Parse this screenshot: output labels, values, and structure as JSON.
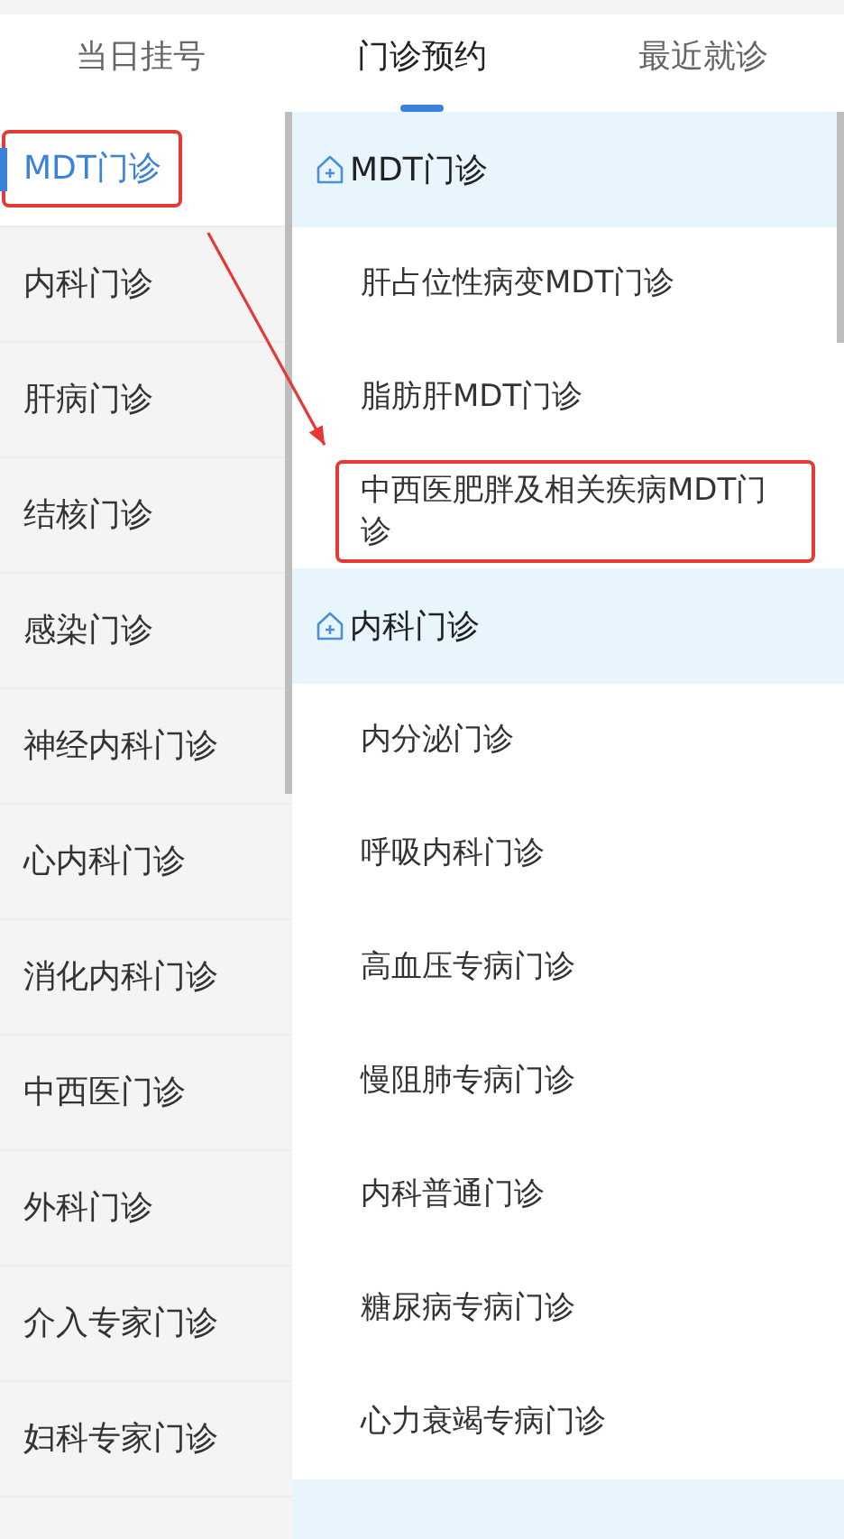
{
  "tabs": [
    {
      "label": "当日挂号",
      "selected": false
    },
    {
      "label": "门诊预约",
      "selected": true
    },
    {
      "label": "最近就诊",
      "selected": false
    }
  ],
  "sidebar": {
    "items": [
      {
        "label": "MDT门诊",
        "selected": true,
        "highlighted": true
      },
      {
        "label": "内科门诊",
        "selected": false,
        "highlighted": false
      },
      {
        "label": "肝病门诊",
        "selected": false,
        "highlighted": false
      },
      {
        "label": "结核门诊",
        "selected": false,
        "highlighted": false
      },
      {
        "label": "感染门诊",
        "selected": false,
        "highlighted": false
      },
      {
        "label": "神经内科门诊",
        "selected": false,
        "highlighted": false
      },
      {
        "label": "心内科门诊",
        "selected": false,
        "highlighted": false
      },
      {
        "label": "消化内科门诊",
        "selected": false,
        "highlighted": false
      },
      {
        "label": "中西医门诊",
        "selected": false,
        "highlighted": false
      },
      {
        "label": "外科门诊",
        "selected": false,
        "highlighted": false
      },
      {
        "label": "介入专家门诊",
        "selected": false,
        "highlighted": false
      },
      {
        "label": "妇科专家门诊",
        "selected": false,
        "highlighted": false
      }
    ]
  },
  "sections": [
    {
      "title": "MDT门诊",
      "items": [
        {
          "label": "肝占位性病变MDT门诊",
          "highlighted": false
        },
        {
          "label": "脂肪肝MDT门诊",
          "highlighted": false
        },
        {
          "label": "中西医肥胖及相关疾病MDT门诊",
          "highlighted": true
        }
      ]
    },
    {
      "title": "内科门诊",
      "items": [
        {
          "label": "内分泌门诊",
          "highlighted": false
        },
        {
          "label": "呼吸内科门诊",
          "highlighted": false
        },
        {
          "label": "高血压专病门诊",
          "highlighted": false
        },
        {
          "label": "慢阻肺专病门诊",
          "highlighted": false
        },
        {
          "label": "内科普通门诊",
          "highlighted": false
        },
        {
          "label": "糖尿病专病门诊",
          "highlighted": false
        },
        {
          "label": "心力衰竭专病门诊",
          "highlighted": false
        }
      ]
    }
  ],
  "annotations": [
    {
      "kind": "arrow"
    }
  ]
}
